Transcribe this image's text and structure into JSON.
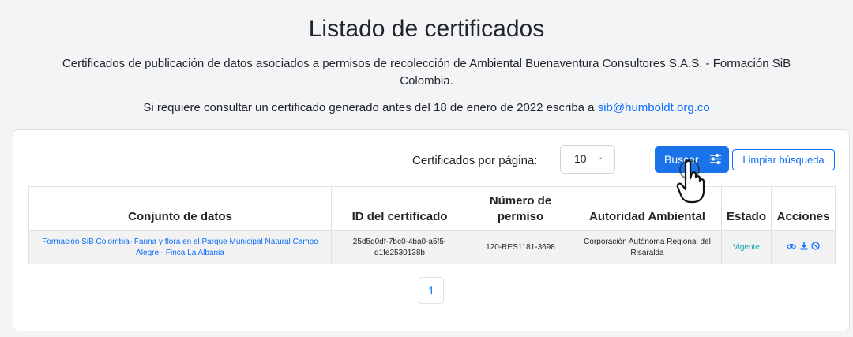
{
  "header": {
    "title": "Listado de certificados",
    "subtitle": "Certificados de publicación de datos asociados a permisos de recolección de Ambiental Buenaventura Consultores S.A.S. - Formación SiB Colombia.",
    "notice_text": "Si requiere consultar un certificado generado antes del 18 de enero de 2022 escriba a ",
    "notice_email": "sib@humboldt.org.co"
  },
  "controls": {
    "perpage_label": "Certificados por página:",
    "perpage_value": "10",
    "search_button": "Buscar",
    "clear_button": "Limpiar búsqueda"
  },
  "table": {
    "headers": [
      "Conjunto de datos",
      "ID del certificado",
      "Número de permiso",
      "Autoridad Ambiental",
      "Estado",
      "Acciones"
    ],
    "rows": [
      {
        "dataset": "Formación SiB Colombia- Fauna y flora en el Parque Municipal Natural Campo Alegre - Finca La Albania",
        "certificate_id": "25d5d0df-7bc0-4ba0-a5f5-d1fe2530138b",
        "permit_number": "120-RES1181-3698",
        "authority": "Corporación Autónoma Regional del Risaralda",
        "status": "Vigente",
        "actions": [
          "eye-icon",
          "download-icon",
          "ban-icon"
        ]
      }
    ]
  },
  "pagination": {
    "current_page": "1"
  },
  "colors": {
    "primary": "#1a73e8",
    "link": "#0d6efd",
    "status": "#17a2b8",
    "background": "#f3f4f6"
  }
}
